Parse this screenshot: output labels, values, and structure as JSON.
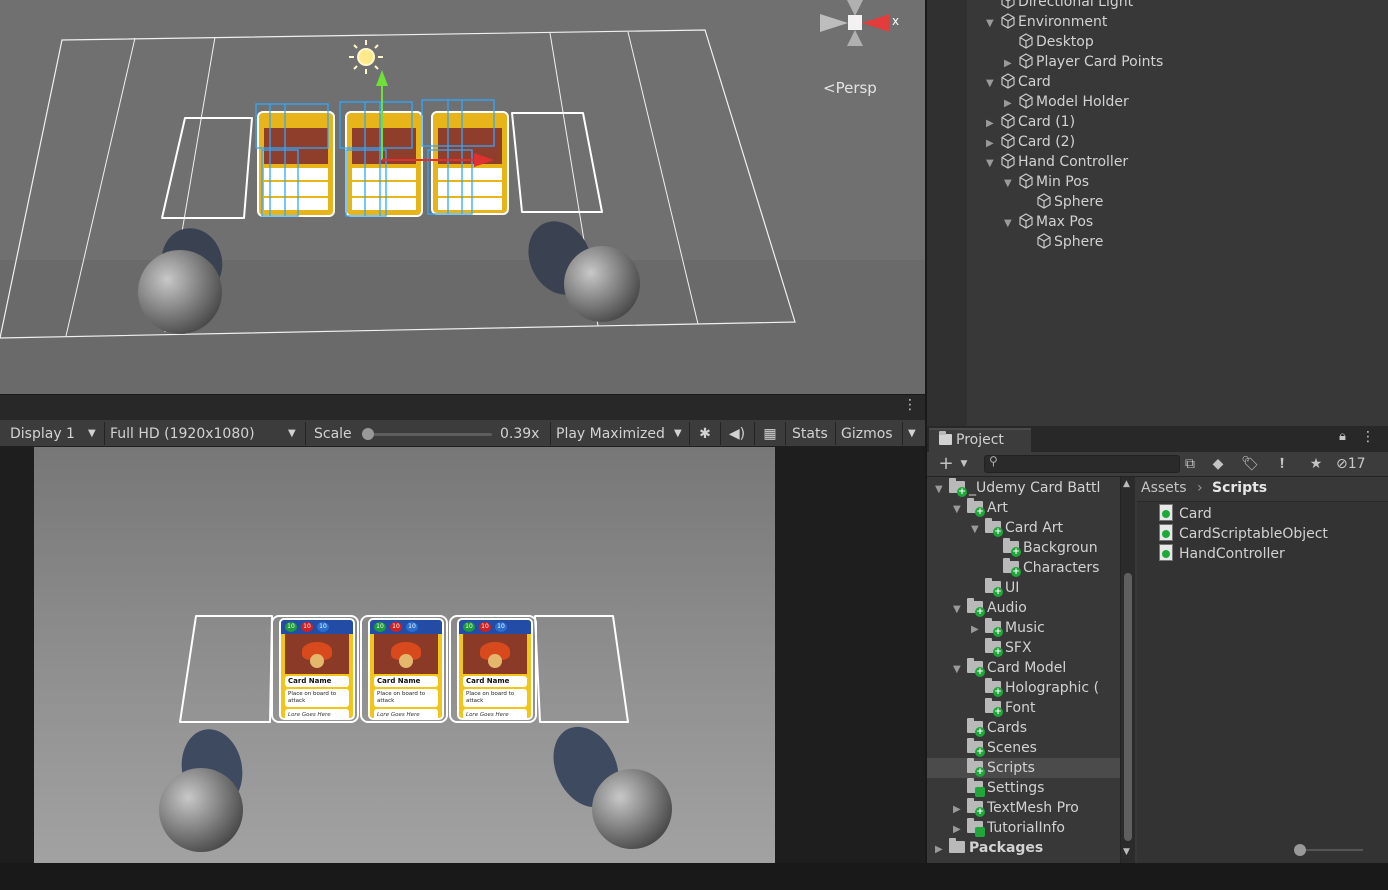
{
  "scene": {
    "persp_label": "Persp",
    "gizmo_axis_label": "x"
  },
  "game_toolbar": {
    "display": "Display 1",
    "resolution": "Full HD (1920x1080)",
    "scale_label": "Scale",
    "scale_value": "0.39x",
    "scale_fraction": 0.0,
    "play_mode": "Play Maximized",
    "stats": "Stats",
    "gizmos": "Gizmos"
  },
  "game_cards": [
    {
      "name": "Card Name",
      "desc": "Place on board to attack",
      "lore": "Lore Goes Here",
      "stats": [
        "10",
        "10",
        "10"
      ]
    },
    {
      "name": "Card Name",
      "desc": "Place on board to attack",
      "lore": "Lore Goes Here",
      "stats": [
        "10",
        "10",
        "10"
      ]
    },
    {
      "name": "Card Name",
      "desc": "Place on board to attack",
      "lore": "Lore Goes Here",
      "stats": [
        "10",
        "10",
        "10"
      ]
    }
  ],
  "hierarchy": {
    "items": [
      {
        "label": "Directional Light",
        "depth": 0,
        "toggle": "none"
      },
      {
        "label": "Environment",
        "depth": 0,
        "toggle": "open"
      },
      {
        "label": "Desktop",
        "depth": 1,
        "toggle": "none"
      },
      {
        "label": "Player Card Points",
        "depth": 1,
        "toggle": "closed"
      },
      {
        "label": "Card",
        "depth": 0,
        "toggle": "open"
      },
      {
        "label": "Model Holder",
        "depth": 1,
        "toggle": "closed"
      },
      {
        "label": "Card (1)",
        "depth": 0,
        "toggle": "closed"
      },
      {
        "label": "Card (2)",
        "depth": 0,
        "toggle": "closed"
      },
      {
        "label": "Hand Controller",
        "depth": 0,
        "toggle": "open"
      },
      {
        "label": "Min Pos",
        "depth": 1,
        "toggle": "open"
      },
      {
        "label": "Sphere",
        "depth": 2,
        "toggle": "none"
      },
      {
        "label": "Max Pos",
        "depth": 1,
        "toggle": "open"
      },
      {
        "label": "Sphere",
        "depth": 2,
        "toggle": "none"
      }
    ]
  },
  "project": {
    "tab_label": "Project",
    "hidden_count": "17",
    "breadcrumb": {
      "root": "Assets",
      "current": "Scripts"
    },
    "tree": [
      {
        "label": "_Udemy Card Battl",
        "depth": 0,
        "toggle": "open",
        "badge": "plus"
      },
      {
        "label": "Art",
        "depth": 1,
        "toggle": "open",
        "badge": "plus"
      },
      {
        "label": "Card Art",
        "depth": 2,
        "toggle": "open",
        "badge": "plus"
      },
      {
        "label": "Backgroun",
        "depth": 3,
        "toggle": "none",
        "badge": "plus"
      },
      {
        "label": "Characters",
        "depth": 3,
        "toggle": "none",
        "badge": "plus"
      },
      {
        "label": "UI",
        "depth": 2,
        "toggle": "none",
        "badge": "plus"
      },
      {
        "label": "Audio",
        "depth": 1,
        "toggle": "open",
        "badge": "plus"
      },
      {
        "label": "Music",
        "depth": 2,
        "toggle": "closed",
        "badge": "plus"
      },
      {
        "label": "SFX",
        "depth": 2,
        "toggle": "none",
        "badge": "plus"
      },
      {
        "label": "Card Model",
        "depth": 1,
        "toggle": "open",
        "badge": "plus"
      },
      {
        "label": "Holographic (",
        "depth": 2,
        "toggle": "none",
        "badge": "plus"
      },
      {
        "label": "Font",
        "depth": 2,
        "toggle": "none",
        "badge": "plus"
      },
      {
        "label": "Cards",
        "depth": 1,
        "toggle": "none",
        "badge": "plus"
      },
      {
        "label": "Scenes",
        "depth": 1,
        "toggle": "none",
        "badge": "plus"
      },
      {
        "label": "Scripts",
        "depth": 1,
        "toggle": "none",
        "badge": "plus",
        "selected": true
      },
      {
        "label": "Settings",
        "depth": 1,
        "toggle": "none",
        "badge": "check"
      },
      {
        "label": "TextMesh Pro",
        "depth": 1,
        "toggle": "closed",
        "badge": "plus"
      },
      {
        "label": "TutorialInfo",
        "depth": 1,
        "toggle": "closed",
        "badge": "check"
      },
      {
        "label": "Packages",
        "depth": 0,
        "toggle": "closed",
        "badge": "none",
        "bold": true
      }
    ],
    "files": [
      "Card",
      "CardScriptableObject",
      "HandController"
    ]
  }
}
